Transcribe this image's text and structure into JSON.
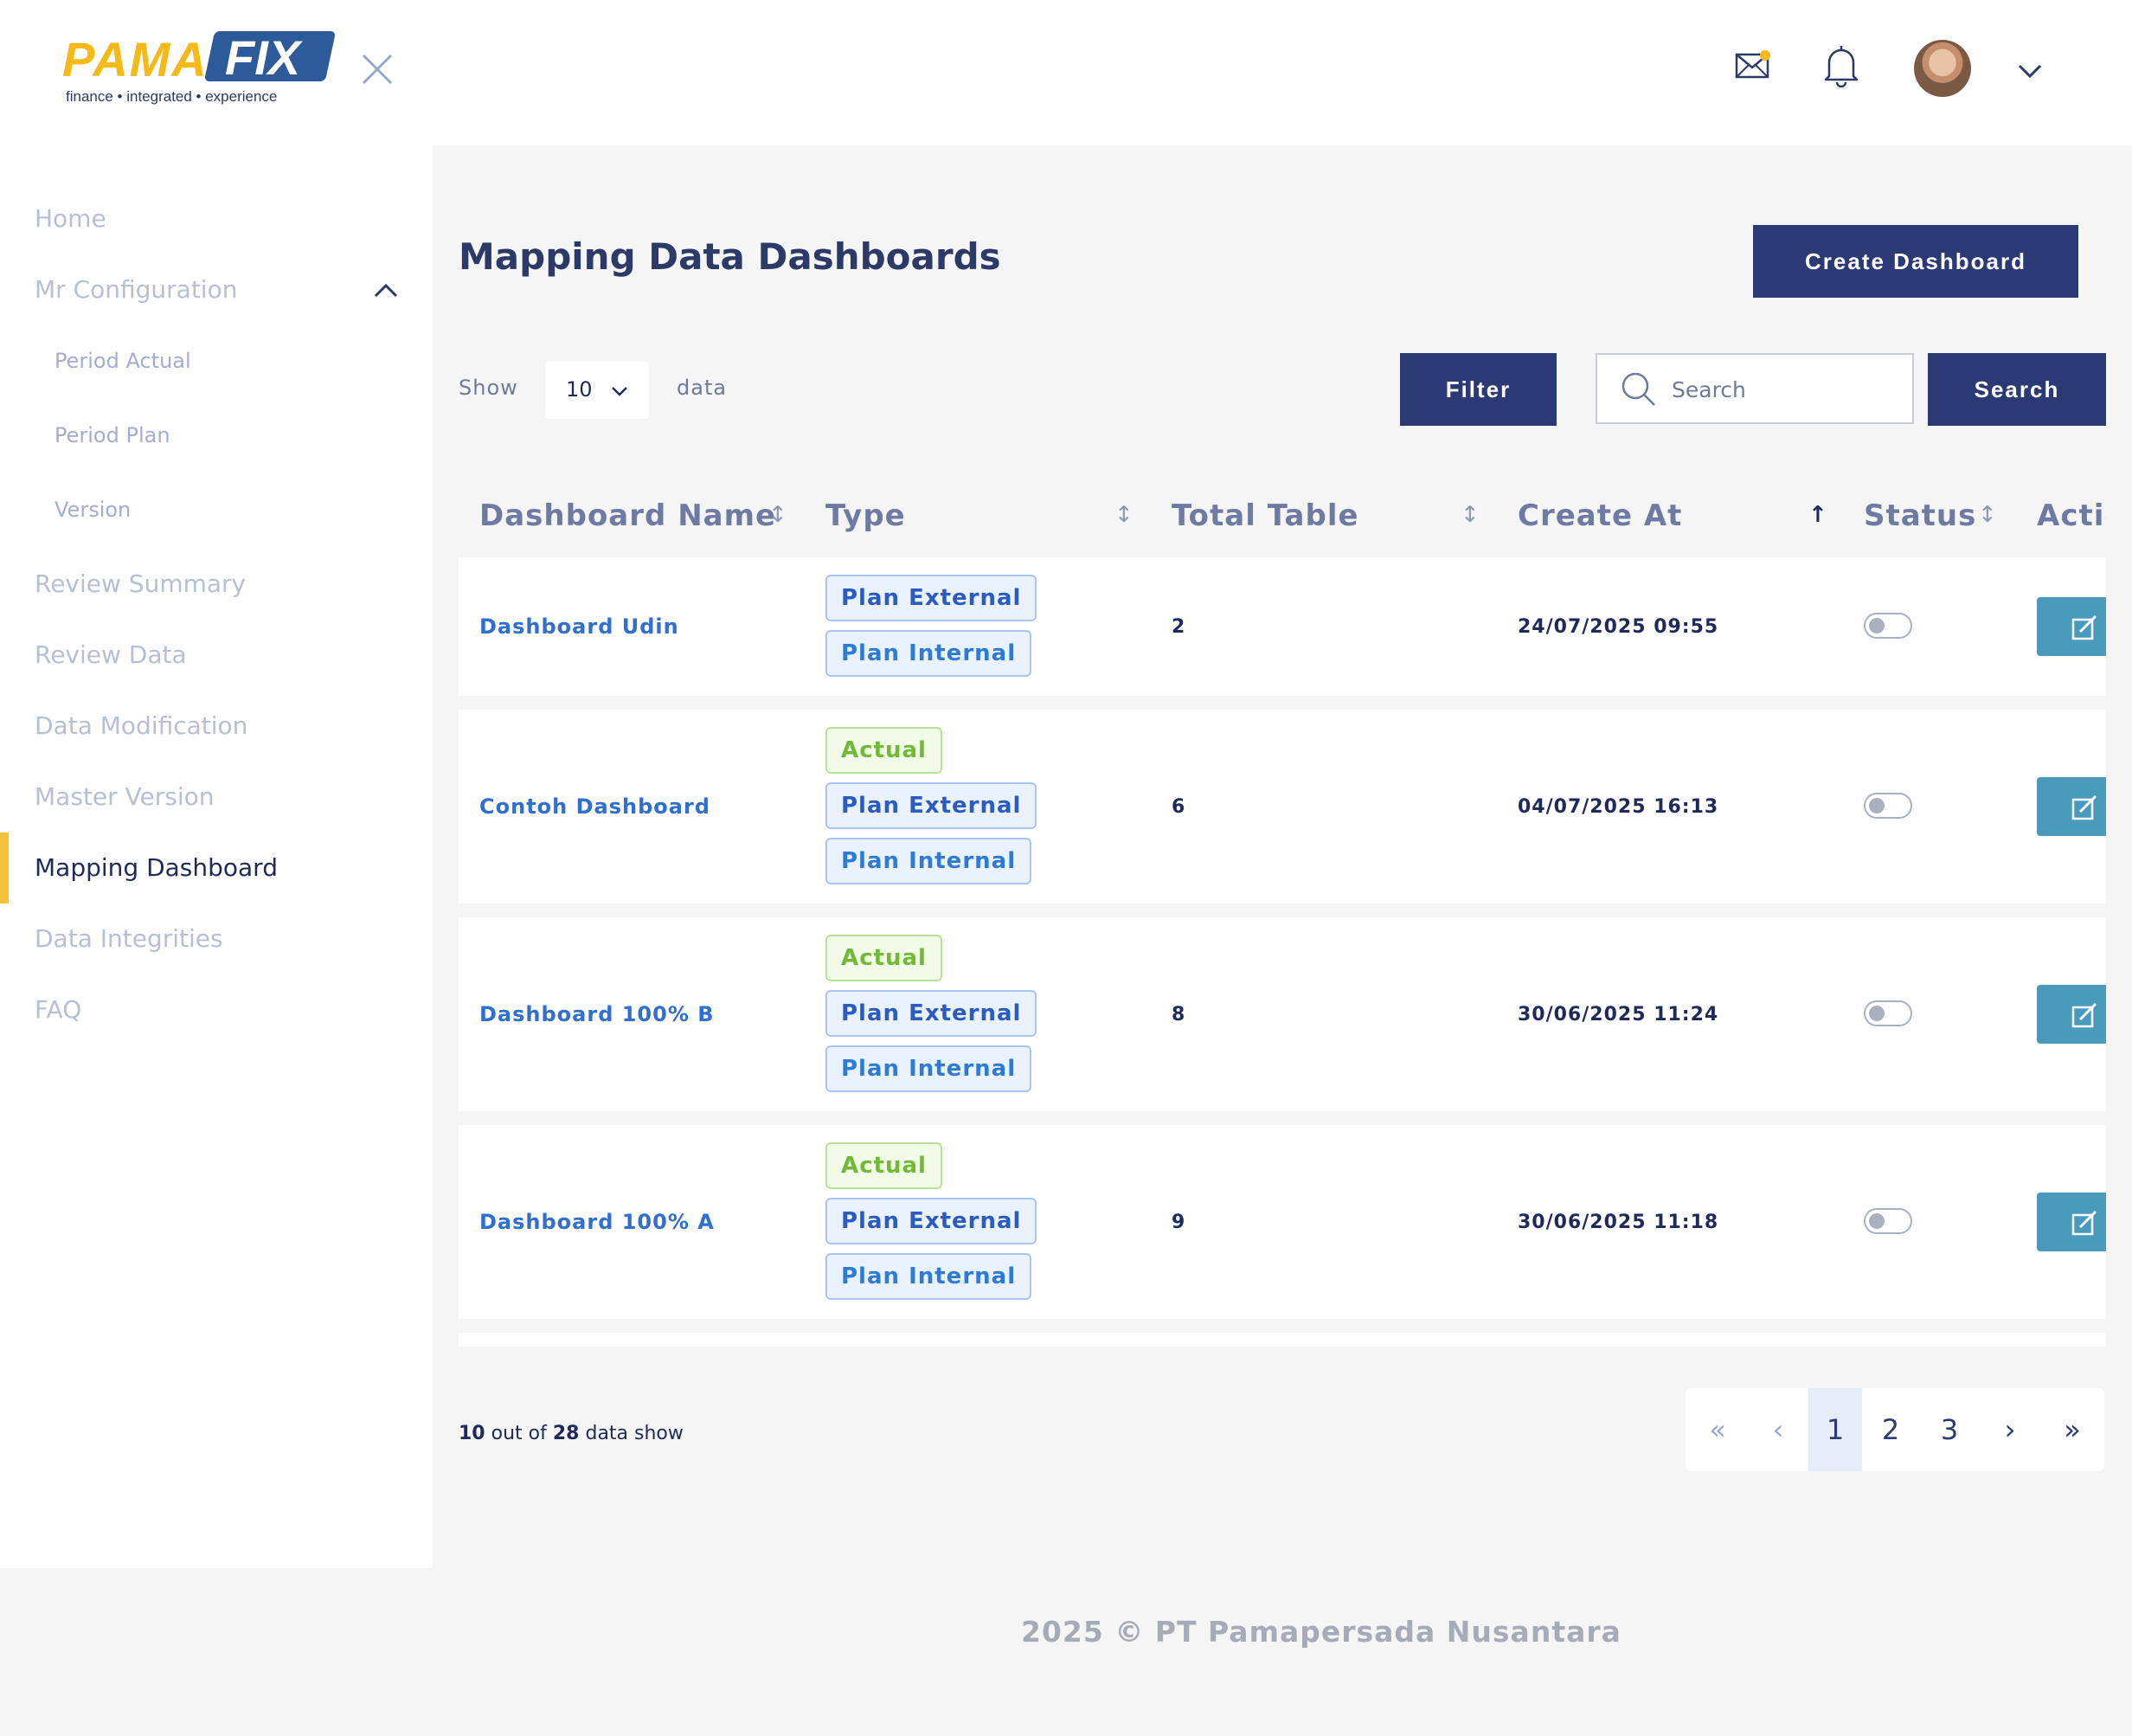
{
  "brand": {
    "name_part1": "PAMA",
    "name_part2": "FIX",
    "tagline": "finance  •  integrated  •  experience"
  },
  "sidebar": {
    "items": [
      {
        "label": "Home"
      },
      {
        "label": "Mr Configuration"
      },
      {
        "label": "Period Actual"
      },
      {
        "label": "Period Plan"
      },
      {
        "label": "Version"
      },
      {
        "label": "Review Summary"
      },
      {
        "label": "Review Data"
      },
      {
        "label": "Data Modification"
      },
      {
        "label": "Master Version"
      },
      {
        "label": "Mapping Dashboard",
        "active": true
      },
      {
        "label": "Data Integrities"
      },
      {
        "label": "FAQ"
      }
    ]
  },
  "header": {
    "icons": [
      "mail-icon",
      "bell-icon",
      "avatar",
      "chevron-down-icon"
    ]
  },
  "main": {
    "title": "Mapping Data Dashboards",
    "create_label": "Create Dashboard",
    "show_label": "Show",
    "show_value": "10",
    "data_label": "data",
    "filter_label": "Filter",
    "search_placeholder": "Search",
    "search_label": "Search"
  },
  "table": {
    "columns": [
      "Dashboard Name",
      "Type",
      "Total Table",
      "Create At",
      "Status",
      "Action"
    ],
    "rows": [
      {
        "name": "Dashboard Udin",
        "types": [
          "Plan External",
          "Plan Internal"
        ],
        "total": "2",
        "created": "24/07/2025 09:55",
        "status": false
      },
      {
        "name": "Contoh Dashboard",
        "types": [
          "Actual",
          "Plan External",
          "Plan Internal"
        ],
        "total": "6",
        "created": "04/07/2025 16:13",
        "status": false
      },
      {
        "name": "Dashboard 100% B",
        "types": [
          "Actual",
          "Plan External",
          "Plan Internal"
        ],
        "total": "8",
        "created": "30/06/2025 11:24",
        "status": false
      },
      {
        "name": "Dashboard 100% A",
        "types": [
          "Actual",
          "Plan External",
          "Plan Internal"
        ],
        "total": "9",
        "created": "30/06/2025 11:18",
        "status": false
      }
    ]
  },
  "pagination": {
    "shown": "10",
    "out_of": "out of",
    "total": "28",
    "suffix": "data show",
    "first": "«",
    "prev": "‹",
    "pages": [
      "1",
      "2",
      "3"
    ],
    "next": "›",
    "last": "»",
    "current": "1"
  },
  "footer": {
    "copyright": "2025 © PT Pamapersada Nusantara"
  },
  "colors": {
    "primary": "#2b3a74",
    "accent": "#f5c23c",
    "action": "#4a9bbb"
  }
}
